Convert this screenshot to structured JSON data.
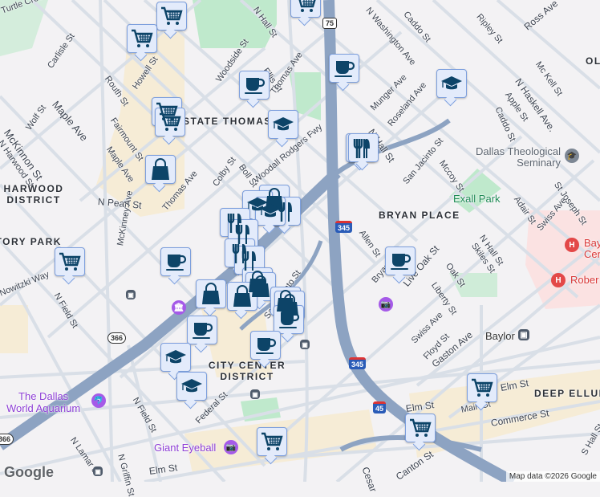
{
  "map": {
    "attribution": "Map data ©2026 Google",
    "logo": "Google",
    "districts": [
      "STATE THOMAS",
      "HARWOOD DISTRICT",
      "VICTORY PARK",
      "BRYAN PLACE",
      "CITY CENTER DISTRICT",
      "DEEP ELLUM",
      "OL"
    ],
    "streets": [
      "Turtle Creek",
      "N Hall St",
      "Carlisle St",
      "Routh St",
      "Howell St",
      "Maple Ave",
      "Wolf St",
      "McKinnon St",
      "N Harwood St",
      "Fairmount St",
      "Maple Ave",
      "Thomas Ave",
      "Colby St",
      "Boll St",
      "Woodall Rodgers Fwy",
      "N Pearl St",
      "McKinney Ave",
      "Woodside St",
      "Ellis St",
      "Thomas Ave",
      "N Washington Ave",
      "Caddo St",
      "Ripley St",
      "Ross Ave",
      "Munger Ave",
      "Roseland Ave",
      "N Hall St",
      "Mc Kell St",
      "Apple St",
      "Caddo St",
      "N Haskell Ave.",
      "San Jacinto St",
      "Mccoy St",
      "Adair St",
      "St Joseph St",
      "Swiss Ave",
      "Allen St",
      "N Hall St",
      "Skiles St",
      "Oak St",
      "Liberty St",
      "Live Oak St",
      "Swiss Ave",
      "Floyd St",
      "Gaston Ave",
      "Elm St",
      "Main St",
      "Commerce St",
      "Elm St",
      "Canton St",
      "Nowitzki Way",
      "N Field St",
      "N Field St",
      "N Lamar St",
      "N Griffin St",
      "Federal St",
      "Elm St",
      "San Jacinto St",
      "Cesar",
      "S Hall St",
      "Bryan St"
    ],
    "places": {
      "seminary": "Dallas Theological Seminary",
      "park": "Exall Park",
      "aquarium_1": "The Dallas",
      "aquarium_2": "World Aquarium",
      "eyeball": "Giant Eyeball",
      "baylor": "Baylor",
      "hospital_1": "Bay",
      "hospital_1b": "Cen",
      "hospital_2": "Rober"
    },
    "shields": {
      "us75": "75",
      "i345a": "345",
      "i345b": "345",
      "i45": "45",
      "tx366": "366",
      "tx366b": "366"
    },
    "colors": {
      "marker_bg": "#e3ebfb",
      "marker_border": "#7d9fdd",
      "icon": "#0d4468",
      "freeway": "#8da3c2",
      "poi": "#a55ae8",
      "hospital": "#e34848"
    }
  }
}
